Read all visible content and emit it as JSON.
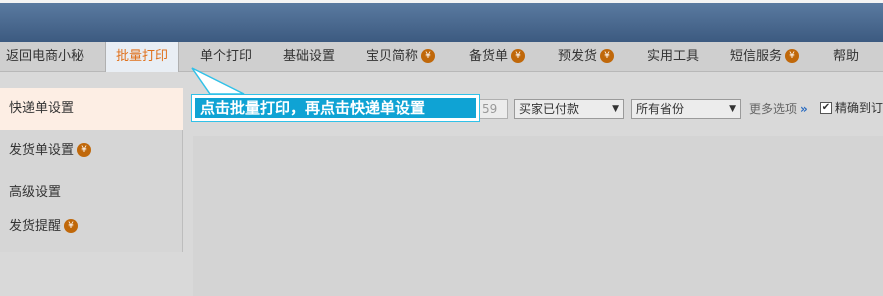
{
  "nav": {
    "items": [
      {
        "label": "返回电商小秘",
        "coin": false
      },
      {
        "label": "批量打印",
        "coin": false,
        "active": true
      },
      {
        "label": "单个打印",
        "coin": false
      },
      {
        "label": "基础设置",
        "coin": false
      },
      {
        "label": "宝贝简称",
        "coin": true
      },
      {
        "label": "备货单",
        "coin": true
      },
      {
        "label": "预发货",
        "coin": true
      },
      {
        "label": "实用工具",
        "coin": false
      },
      {
        "label": "短信服务",
        "coin": true
      },
      {
        "label": "帮助",
        "coin": false
      }
    ],
    "coin_symbol": "¥"
  },
  "sidebar": {
    "items": [
      {
        "label": "快递单设置",
        "coin": false,
        "active": true
      },
      {
        "label": "发货单设置",
        "coin": true
      },
      {
        "label": "高级设置",
        "coin": false
      },
      {
        "label": "发货提醒",
        "coin": true
      }
    ]
  },
  "filters": {
    "time_partial": "59",
    "status_select": "买家已付款",
    "province_select": "所有省份",
    "more_options": "更多选项",
    "more_chevron": "»",
    "precise_label": "精确到订",
    "precise_checked": true
  },
  "callout": {
    "text": "点击批量打印，再点击快递单设置"
  },
  "colors": {
    "header": "#3c5a80",
    "active_nav_text": "#e0701a",
    "coin": "#c0680a",
    "callout_fill": "#0fa3d4",
    "callout_border": "#31c1e8"
  }
}
